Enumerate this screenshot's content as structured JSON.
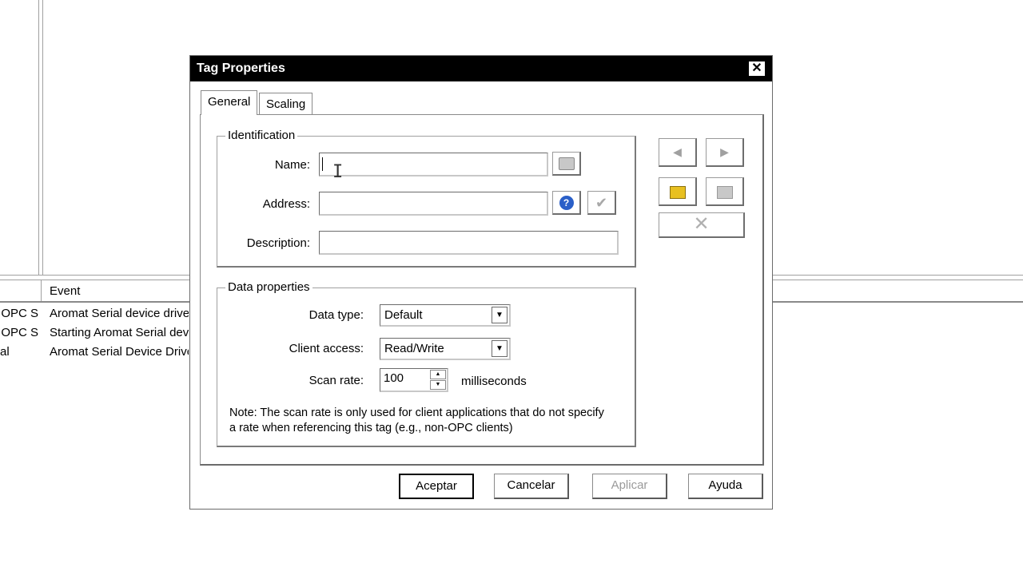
{
  "background": {
    "table": {
      "event_header": "Event",
      "rows": [
        {
          "source": "OPC S...",
          "event": "Aromat Serial device driver"
        },
        {
          "source": "OPC S...",
          "event": "Starting Aromat Serial device"
        },
        {
          "source": "al",
          "event": "Aromat Serial Device Driver"
        }
      ]
    }
  },
  "dialog": {
    "title": "Tag Properties",
    "close_label": "✕",
    "tabs": [
      {
        "label": "General",
        "active": true
      },
      {
        "label": "Scaling",
        "active": false
      }
    ],
    "identification": {
      "title": "Identification",
      "name_label": "Name:",
      "name_value": "",
      "address_label": "Address:",
      "address_value": "",
      "description_label": "Description:",
      "description_value": ""
    },
    "data_properties": {
      "title": "Data properties",
      "data_type_label": "Data type:",
      "data_type_value": "Default",
      "client_access_label": "Client access:",
      "client_access_value": "Read/Write",
      "scan_rate_label": "Scan rate:",
      "scan_rate_value": "100",
      "scan_rate_unit": "milliseconds",
      "note": "Note: The scan rate is only used for client applications that do not specify a rate when referencing this tag (e.g., non-OPC clients)"
    },
    "buttons": {
      "ok": "Aceptar",
      "cancel": "Cancelar",
      "apply": "Aplicar",
      "help": "Ayuda"
    }
  },
  "colors": {
    "titlebar": "#000000",
    "help_icon": "#2a5fc8",
    "new_tag_icon": "#e8c020"
  }
}
